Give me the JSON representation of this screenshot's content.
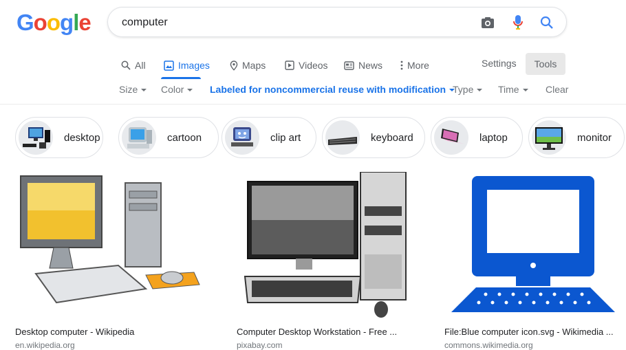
{
  "logo": {
    "letters": [
      "G",
      "o",
      "o",
      "g",
      "l",
      "e"
    ],
    "colors": [
      "#4285f4",
      "#ea4335",
      "#fbbc05",
      "#4285f4",
      "#34a853",
      "#ea4335"
    ]
  },
  "search": {
    "query": "computer"
  },
  "tabs": [
    {
      "label": "All",
      "icon": "search-icon"
    },
    {
      "label": "Images",
      "icon": "image-icon",
      "active": true
    },
    {
      "label": "Maps",
      "icon": "map-pin-icon"
    },
    {
      "label": "Videos",
      "icon": "video-icon"
    },
    {
      "label": "News",
      "icon": "news-icon"
    },
    {
      "label": "More",
      "icon": "more-vert-icon"
    }
  ],
  "settings_label": "Settings",
  "tools_label": "Tools",
  "filters": {
    "size": "Size",
    "color": "Color",
    "usage": "Labeled for noncommercial reuse with modification",
    "type": "Type",
    "time": "Time",
    "clear": "Clear"
  },
  "chips": [
    {
      "label": "desktop"
    },
    {
      "label": "cartoon"
    },
    {
      "label": "clip art"
    },
    {
      "label": "keyboard"
    },
    {
      "label": "laptop"
    },
    {
      "label": "monitor"
    }
  ],
  "results": [
    {
      "title": "Desktop computer - Wikipedia",
      "source": "en.wikipedia.org"
    },
    {
      "title": "Computer Desktop Workstation - Free ...",
      "source": "pixabay.com"
    },
    {
      "title": "File:Blue computer icon.svg - Wikimedia ...",
      "source": "commons.wikimedia.org"
    }
  ],
  "colors": {
    "accent": "#1a73e8",
    "icon_blue": "#0b57d0"
  }
}
